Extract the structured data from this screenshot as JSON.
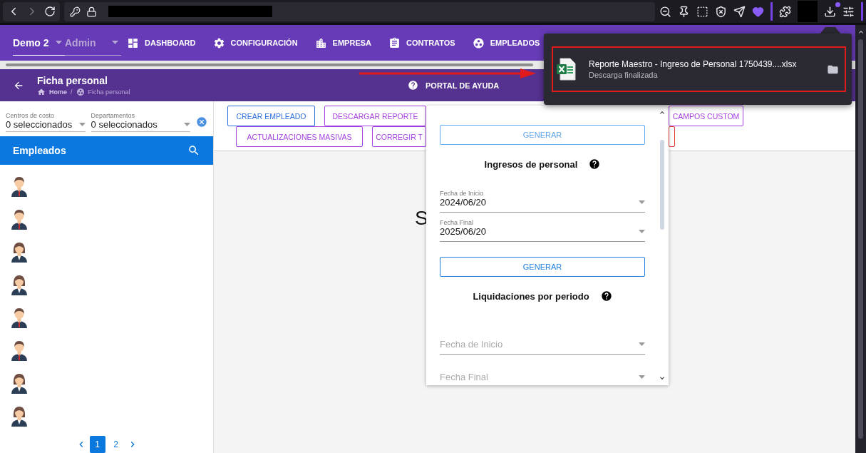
{
  "header": {
    "company": "Demo 2",
    "role": "Admin",
    "nav": [
      {
        "label": "DASHBOARD",
        "kind": "dashboard"
      },
      {
        "label": "CONFIGURACIÓN",
        "kind": "settings"
      },
      {
        "label": "EMPRESA",
        "kind": "building"
      },
      {
        "label": "CONTRATOS",
        "kind": "clipboard"
      },
      {
        "label": "EMPLEADOS",
        "kind": "group"
      }
    ]
  },
  "subheader": {
    "title": "Ficha personal",
    "breadcrumb": [
      "Home",
      "Ficha personal"
    ],
    "separator": "/",
    "help_link": "PORTAL DE AYUDA"
  },
  "filters": [
    {
      "label": "Centros de costo",
      "value": "0 seleccionados"
    },
    {
      "label": "Departamentos",
      "value": "0 seleccionados"
    }
  ],
  "employees": {
    "title": "Empleados",
    "items": [
      {
        "kind": "man"
      },
      {
        "kind": "man"
      },
      {
        "kind": "woman"
      },
      {
        "kind": "woman"
      },
      {
        "kind": "man"
      },
      {
        "kind": "man"
      },
      {
        "kind": "woman"
      },
      {
        "kind": "woman"
      }
    ],
    "pages": [
      {
        "label": "1",
        "selected": true
      },
      {
        "label": "2",
        "selected": false
      }
    ]
  },
  "actions": [
    [
      {
        "label": "CREAR EMPLEADO",
        "color": "#2f6fdc"
      },
      {
        "label": "DESCARGAR REPORTE",
        "color": "#a640e0"
      },
      {
        "label": "CAMPOS CUSTOM",
        "color": "#a640e0"
      }
    ],
    [
      {
        "label": "ACTUALIZACIONES MASIVAS",
        "color": "#a640e0"
      },
      {
        "label": "CORREGIR T",
        "color": "#a640e0"
      },
      {
        "color": "#e53935"
      }
    ]
  ],
  "main_message": "S",
  "report_popover": {
    "top_button": "GENERAR",
    "sections": [
      {
        "title": "Ingresos de personal",
        "fields": [
          {
            "label": "Fecha de Inicio",
            "value": "2024/06/20"
          },
          {
            "label": "Fecha Final",
            "value": "2025/06/20"
          }
        ],
        "button": "GENERAR"
      },
      {
        "title": "Liquidaciones por periodo",
        "fields": [
          {
            "placeholder": "Fecha de Inicio"
          },
          {
            "placeholder": "Fecha Final"
          }
        ]
      }
    ]
  },
  "download_panel": {
    "filename": "Reporte Maestro - Ingreso de Personal 1750439....xlsx",
    "status": "Descarga finalizada"
  }
}
